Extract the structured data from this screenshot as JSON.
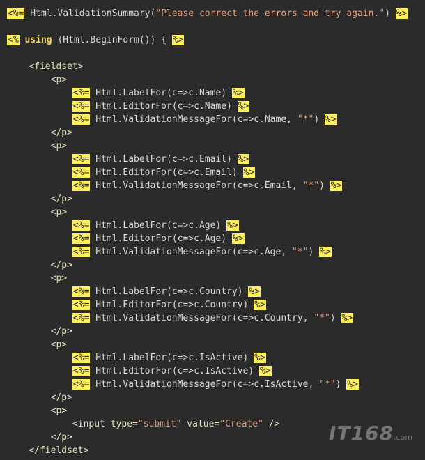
{
  "colors": {
    "background": "#2b2b2b",
    "delimiter_bg": "#ffef5a",
    "string": "#e2a083",
    "keyword": "#f5d76e",
    "text": "#d8d8d0"
  },
  "code_lines": [
    [
      {
        "t": "delim",
        "v": "<%="
      },
      {
        "t": "code",
        "v": " Html.ValidationSummary("
      },
      {
        "t": "str",
        "v": "\"Please correct the errors and try again.\""
      },
      {
        "t": "code",
        "v": ") "
      },
      {
        "t": "delim",
        "v": "%>"
      }
    ],
    [],
    [
      {
        "t": "delim",
        "v": "<%"
      },
      {
        "t": "code",
        "v": " "
      },
      {
        "t": "kw",
        "v": "using"
      },
      {
        "t": "code",
        "v": " (Html.BeginForm()) { "
      },
      {
        "t": "delim",
        "v": "%>"
      }
    ],
    [],
    [
      {
        "t": "code",
        "v": "    "
      },
      {
        "t": "tag",
        "v": "<fieldset>"
      }
    ],
    [
      {
        "t": "code",
        "v": "        "
      },
      {
        "t": "tag",
        "v": "<p>"
      }
    ],
    [
      {
        "t": "code",
        "v": "            "
      },
      {
        "t": "delim",
        "v": "<%="
      },
      {
        "t": "code",
        "v": " Html.LabelFor(c=>c.Name) "
      },
      {
        "t": "delim",
        "v": "%>"
      }
    ],
    [
      {
        "t": "code",
        "v": "            "
      },
      {
        "t": "delim",
        "v": "<%="
      },
      {
        "t": "code",
        "v": " Html.EditorFor(c=>c.Name) "
      },
      {
        "t": "delim",
        "v": "%>"
      }
    ],
    [
      {
        "t": "code",
        "v": "            "
      },
      {
        "t": "delim",
        "v": "<%="
      },
      {
        "t": "code",
        "v": " Html.ValidationMessageFor(c=>c.Name, "
      },
      {
        "t": "str",
        "v": "\"*\""
      },
      {
        "t": "code",
        "v": ") "
      },
      {
        "t": "delim",
        "v": "%>"
      }
    ],
    [
      {
        "t": "code",
        "v": "        "
      },
      {
        "t": "tag",
        "v": "</p>"
      }
    ],
    [
      {
        "t": "code",
        "v": "        "
      },
      {
        "t": "tag",
        "v": "<p>"
      }
    ],
    [
      {
        "t": "code",
        "v": "            "
      },
      {
        "t": "delim",
        "v": "<%="
      },
      {
        "t": "code",
        "v": " Html.LabelFor(c=>c.Email) "
      },
      {
        "t": "delim",
        "v": "%>"
      }
    ],
    [
      {
        "t": "code",
        "v": "            "
      },
      {
        "t": "delim",
        "v": "<%="
      },
      {
        "t": "code",
        "v": " Html.EditorFor(c=>c.Email) "
      },
      {
        "t": "delim",
        "v": "%>"
      }
    ],
    [
      {
        "t": "code",
        "v": "            "
      },
      {
        "t": "delim",
        "v": "<%="
      },
      {
        "t": "code",
        "v": " Html.ValidationMessageFor(c=>c.Email, "
      },
      {
        "t": "str",
        "v": "\"*\""
      },
      {
        "t": "code",
        "v": ") "
      },
      {
        "t": "delim",
        "v": "%>"
      }
    ],
    [
      {
        "t": "code",
        "v": "        "
      },
      {
        "t": "tag",
        "v": "</p>"
      }
    ],
    [
      {
        "t": "code",
        "v": "        "
      },
      {
        "t": "tag",
        "v": "<p>"
      }
    ],
    [
      {
        "t": "code",
        "v": "            "
      },
      {
        "t": "delim",
        "v": "<%="
      },
      {
        "t": "code",
        "v": " Html.LabelFor(c=>c.Age) "
      },
      {
        "t": "delim",
        "v": "%>"
      }
    ],
    [
      {
        "t": "code",
        "v": "            "
      },
      {
        "t": "delim",
        "v": "<%="
      },
      {
        "t": "code",
        "v": " Html.EditorFor(c=>c.Age) "
      },
      {
        "t": "delim",
        "v": "%>"
      }
    ],
    [
      {
        "t": "code",
        "v": "            "
      },
      {
        "t": "delim",
        "v": "<%="
      },
      {
        "t": "code",
        "v": " Html.ValidationMessageFor(c=>c.Age, "
      },
      {
        "t": "str",
        "v": "\"*\""
      },
      {
        "t": "code",
        "v": ") "
      },
      {
        "t": "delim",
        "v": "%>"
      }
    ],
    [
      {
        "t": "code",
        "v": "        "
      },
      {
        "t": "tag",
        "v": "</p>"
      }
    ],
    [
      {
        "t": "code",
        "v": "        "
      },
      {
        "t": "tag",
        "v": "<p>"
      }
    ],
    [
      {
        "t": "code",
        "v": "            "
      },
      {
        "t": "delim",
        "v": "<%="
      },
      {
        "t": "code",
        "v": " Html.LabelFor(c=>c.Country) "
      },
      {
        "t": "delim",
        "v": "%>"
      }
    ],
    [
      {
        "t": "code",
        "v": "            "
      },
      {
        "t": "delim",
        "v": "<%="
      },
      {
        "t": "code",
        "v": " Html.EditorFor(c=>c.Country) "
      },
      {
        "t": "delim",
        "v": "%>"
      }
    ],
    [
      {
        "t": "code",
        "v": "            "
      },
      {
        "t": "delim",
        "v": "<%="
      },
      {
        "t": "code",
        "v": " Html.ValidationMessageFor(c=>c.Country, "
      },
      {
        "t": "str",
        "v": "\"*\""
      },
      {
        "t": "code",
        "v": ") "
      },
      {
        "t": "delim",
        "v": "%>"
      }
    ],
    [
      {
        "t": "code",
        "v": "        "
      },
      {
        "t": "tag",
        "v": "</p>"
      }
    ],
    [
      {
        "t": "code",
        "v": "        "
      },
      {
        "t": "tag",
        "v": "<p>"
      }
    ],
    [
      {
        "t": "code",
        "v": "            "
      },
      {
        "t": "delim",
        "v": "<%="
      },
      {
        "t": "code",
        "v": " Html.LabelFor(c=>c.IsActive) "
      },
      {
        "t": "delim",
        "v": "%>"
      }
    ],
    [
      {
        "t": "code",
        "v": "            "
      },
      {
        "t": "delim",
        "v": "<%="
      },
      {
        "t": "code",
        "v": " Html.EditorFor(c=>c.IsActive) "
      },
      {
        "t": "delim",
        "v": "%>"
      }
    ],
    [
      {
        "t": "code",
        "v": "            "
      },
      {
        "t": "delim",
        "v": "<%="
      },
      {
        "t": "code",
        "v": " Html.ValidationMessageFor(c=>c.IsActive, "
      },
      {
        "t": "str",
        "v": "\"*\""
      },
      {
        "t": "code",
        "v": ") "
      },
      {
        "t": "delim",
        "v": "%>"
      }
    ],
    [
      {
        "t": "code",
        "v": "        "
      },
      {
        "t": "tag",
        "v": "</p>"
      }
    ],
    [
      {
        "t": "code",
        "v": "        "
      },
      {
        "t": "tag",
        "v": "<p>"
      }
    ],
    [
      {
        "t": "code",
        "v": "            "
      },
      {
        "t": "tag",
        "v": "<input "
      },
      {
        "t": "attr",
        "v": "type="
      },
      {
        "t": "str",
        "v": "\"submit\""
      },
      {
        "t": "attr",
        "v": " value="
      },
      {
        "t": "str",
        "v": "\"Create\""
      },
      {
        "t": "tag",
        "v": " />"
      }
    ],
    [
      {
        "t": "code",
        "v": "        "
      },
      {
        "t": "tag",
        "v": "</p>"
      }
    ],
    [
      {
        "t": "code",
        "v": "    "
      },
      {
        "t": "tag",
        "v": "</fieldset>"
      }
    ]
  ],
  "watermark": {
    "text": "IT168",
    "suffix": ".com"
  }
}
